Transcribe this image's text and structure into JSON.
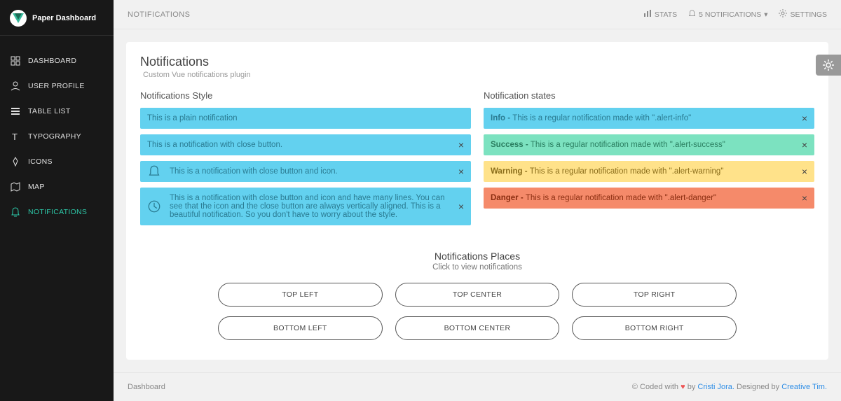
{
  "brand": "Paper Dashboard",
  "sidebar": {
    "items": [
      {
        "label": "DASHBOARD"
      },
      {
        "label": "USER PROFILE"
      },
      {
        "label": "TABLE LIST"
      },
      {
        "label": "TYPOGRAPHY"
      },
      {
        "label": "ICONS"
      },
      {
        "label": "MAP"
      },
      {
        "label": "NOTIFICATIONS"
      }
    ]
  },
  "topbar": {
    "title": "NOTIFICATIONS",
    "stats": "STATS",
    "notifications": "5 NOTIFICATIONS",
    "settings": "SETTINGS"
  },
  "page": {
    "title": "Notifications",
    "subtitle": "Custom Vue notifications plugin"
  },
  "style_section": {
    "heading": "Notifications Style",
    "plain": "This is a plain notification",
    "withClose": "This is a notification with close button.",
    "withIcon": "This is a notification with close button and icon.",
    "multiline": "This is a notification with close button and icon and have many lines. You can see that the icon and the close button are always vertically aligned. This is a beautiful notification. So you don't have to worry about the style."
  },
  "states_section": {
    "heading": "Notification states",
    "info_label": "Info - ",
    "info_text": "This is a regular notification made with \".alert-info\"",
    "success_label": "Success - ",
    "success_text": "This is a regular notification made with \".alert-success\"",
    "warning_label": "Warning - ",
    "warning_text": "This is a regular notification made with \".alert-warning\"",
    "danger_label": "Danger - ",
    "danger_text": "This is a regular notification made with \".alert-danger\""
  },
  "places": {
    "title": "Notifications Places",
    "subtitle": "Click to view notifications",
    "buttons": [
      "TOP LEFT",
      "TOP CENTER",
      "TOP RIGHT",
      "BOTTOM LEFT",
      "BOTTOM CENTER",
      "BOTTOM RIGHT"
    ]
  },
  "footer": {
    "left": "Dashboard",
    "coded": "© Coded with ",
    "by": " by ",
    "author": "Cristi Jora.",
    "designed": "  Designed by ",
    "designer": "Creative Tim."
  }
}
